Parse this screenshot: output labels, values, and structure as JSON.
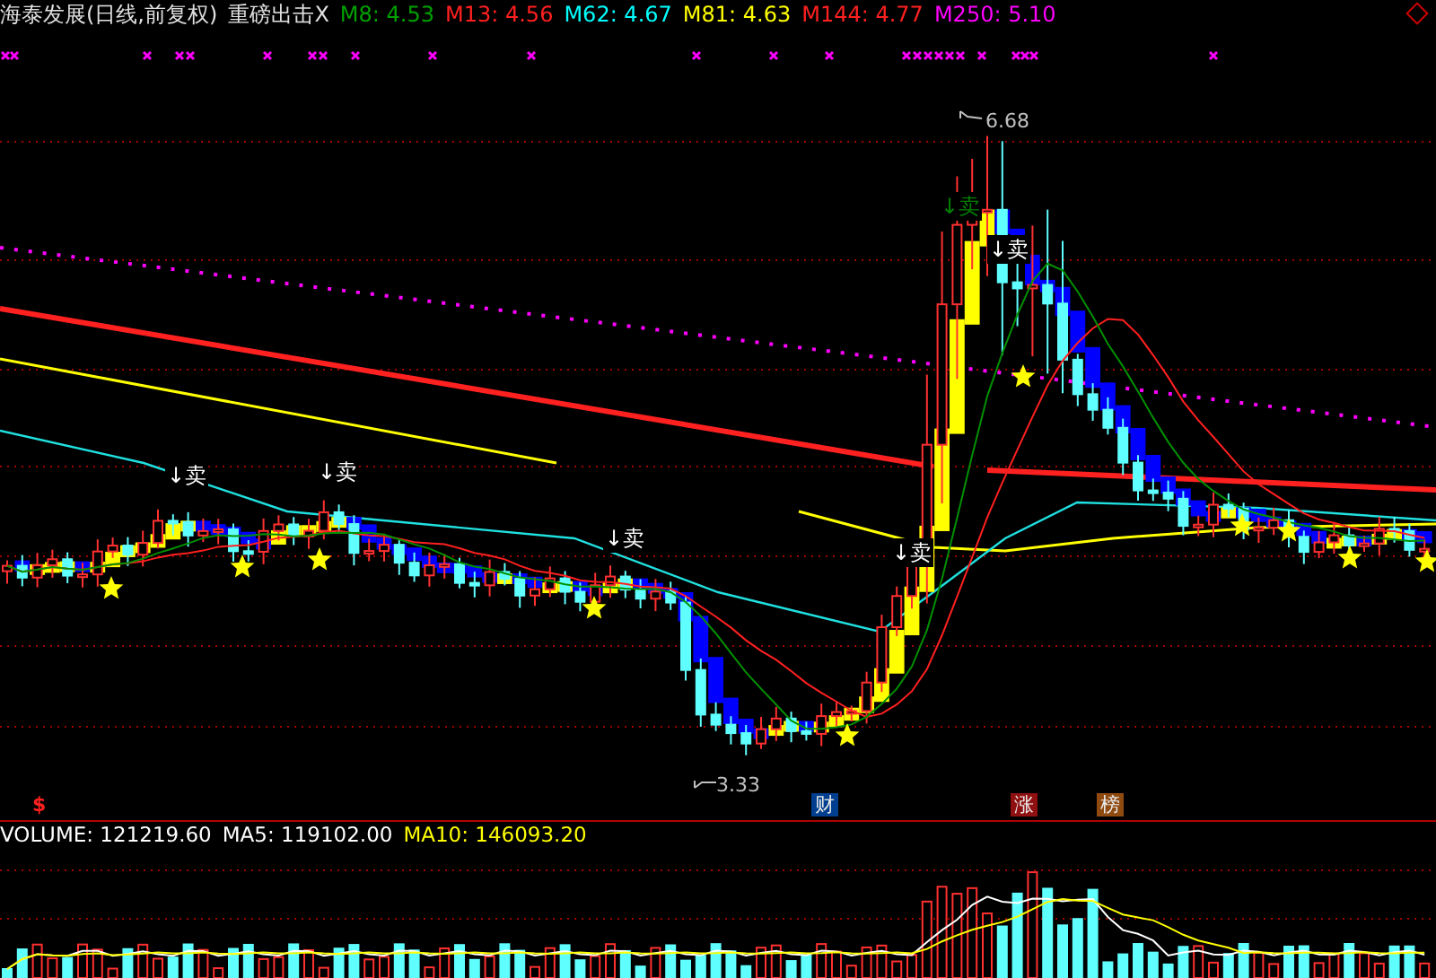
{
  "header": {
    "title": "海泰发展(日线,前复权)",
    "indicator": "重磅出击X",
    "legend": [
      {
        "text": "M8: 4.53",
        "color": "#00a000"
      },
      {
        "text": "M13: 4.56",
        "color": "#ff2020"
      },
      {
        "text": "M62: 4.67",
        "color": "#00ffff"
      },
      {
        "text": "M81: 4.63",
        "color": "#ffff00"
      },
      {
        "text": "M144: 4.77",
        "color": "#ff2020"
      },
      {
        "text": "M250: 5.10",
        "color": "#ff00ff"
      }
    ]
  },
  "chart": {
    "high_label": "6.68",
    "low_label": "3.33",
    "signals": [
      {
        "text": "↓卖",
        "kind": "active"
      },
      {
        "text": "↓卖",
        "kind": "active"
      },
      {
        "text": "↓卖",
        "kind": "active"
      },
      {
        "text": "↓卖",
        "kind": "active"
      },
      {
        "text": "↓卖",
        "kind": "active"
      },
      {
        "text": "↓卖",
        "kind": "faded"
      }
    ]
  },
  "markers": {
    "dollar": "$",
    "badges": [
      {
        "text": "财",
        "color": "#003f8f"
      },
      {
        "text": "涨",
        "color": "#8f1010"
      },
      {
        "text": "榜",
        "color": "#8f4a10"
      }
    ]
  },
  "volume": {
    "legend": [
      {
        "text": "VOLUME: 121219.60",
        "color": "#ffffff"
      },
      {
        "text": "MA5: 119102.00",
        "color": "#ffffff"
      },
      {
        "text": "MA10: 146093.20",
        "color": "#ffff00"
      }
    ]
  }
}
